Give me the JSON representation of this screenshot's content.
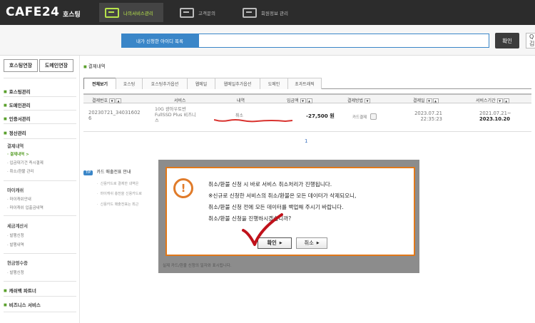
{
  "header": {
    "logo": "CAFE24",
    "logo_sub": "호스팅",
    "nav": [
      {
        "label": "나의서비스관리",
        "icon": "service-icon",
        "active": true
      },
      {
        "label": "고객문의",
        "icon": "support-icon",
        "active": false
      },
      {
        "label": "회원정보 관리",
        "icon": "member-icon",
        "active": false
      }
    ]
  },
  "search": {
    "label": "내가 신청한 아이디 목록",
    "value": "",
    "button": "확인",
    "right_text": "Q 김"
  },
  "sidebar": {
    "tabs": [
      "호스팅연장",
      "도메인연장"
    ],
    "groups": [
      {
        "label": "호스팅관리"
      },
      {
        "label": "도메인관리"
      },
      {
        "label": "인증서관리"
      },
      {
        "label": "정산관리"
      }
    ],
    "billing_title": "결제내역",
    "billing_links": [
      "· 결제내역 >",
      "· 입금대기건 즉시결제",
      "· 취소/환불 관리"
    ],
    "mileage_title": "마이캐쉬",
    "mileage_links": [
      "· 마이캐쉬안내",
      "· 마이캐쉬 입출금내역"
    ],
    "tax_title": "세금계산서",
    "tax_links": [
      "· 발행신청",
      "· 발행내역"
    ],
    "receipt_title": "현금영수증",
    "receipt_links": [
      "· 발행신청"
    ],
    "bottom": [
      "캐쉬백 파트너",
      "비즈니스 서비스"
    ]
  },
  "main": {
    "title": "결제내역",
    "tabs": [
      "전체보기",
      "호스팅",
      "호스팅추가옵션",
      "웹메일",
      "웹메일추가옵션",
      "도메인",
      "초과트래픽"
    ],
    "columns": [
      "결제번호",
      "서비스",
      "내역",
      "입금액",
      "결제방법",
      "결제일",
      "서비스기간"
    ],
    "rows": [
      {
        "order_no_1": "20230721_34031602",
        "order_no_2": "6",
        "service_1": "10G 광아우토반",
        "service_2": "FullSSD Plus 비즈니",
        "service_3": "스",
        "detail": "취소",
        "amount": "-27,500 원",
        "method": "카드결제",
        "date_1": "2023.07.21",
        "date_2": "22:35:23",
        "period_1": "2021.07.21~",
        "period_2": "2023.10.20"
      }
    ],
    "page": "1",
    "tip": {
      "badge": "TIP",
      "title": "카드 매출전표 안내",
      "lines": [
        "신용카드로 결제한 내역은",
        "마이캐쉬 충전을 신용카드로",
        "신용카드 매출전표는 최근"
      ]
    }
  },
  "dialog": {
    "lines": [
      "취소/환불 신청 시 바로 서비스 취소처리가 진행됩니다.",
      "※신규로 신청한 서비스의 취소/환불은 모든 데이터가 삭제되오니,",
      "취소/환불 신청 전에 모든 데이터를 백업해 주시기 바랍니다.",
      "취소/환불 신청을 진행하시겠습니까?"
    ],
    "ok": "확인",
    "cancel": "취소",
    "hint": "실제 카드/환불 신청의 일자와 표시됩니다."
  },
  "colors": {
    "accent_green": "#5aa02c",
    "active_nav": "#b7e34b",
    "dialog_border": "#e0781a",
    "blue": "#3a86c8"
  }
}
